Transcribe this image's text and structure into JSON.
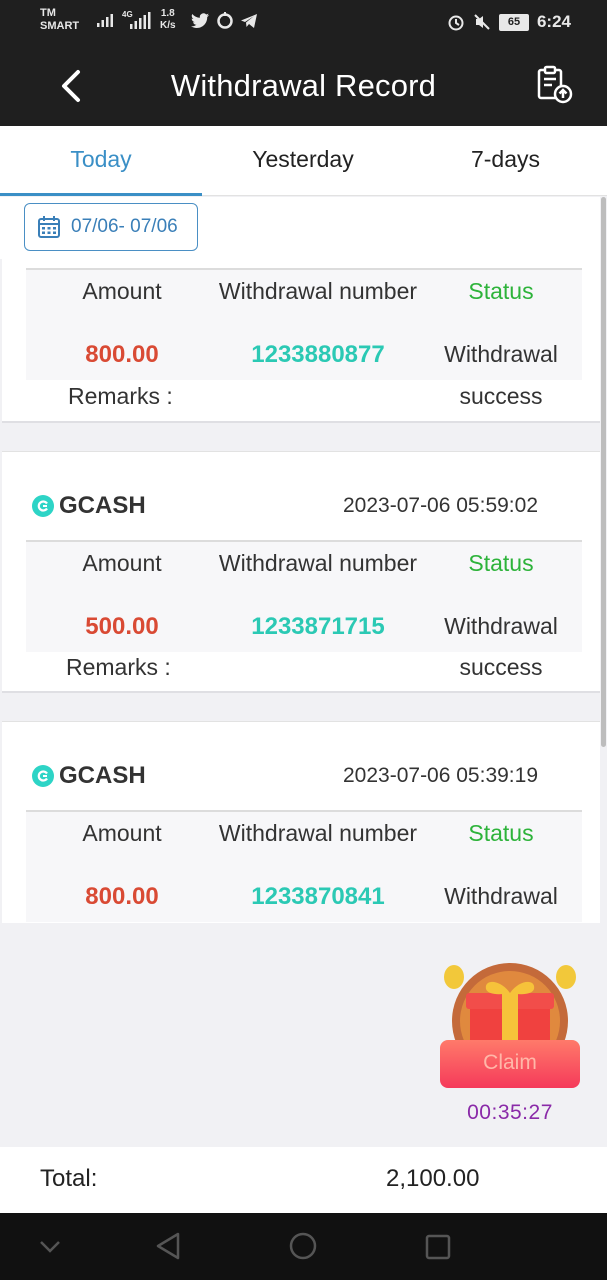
{
  "status_bar": {
    "carrier_line1": "TM",
    "carrier_line2": "SMART",
    "network_type": "4G",
    "speed_value": "1.8",
    "speed_unit": "K/s",
    "battery": "65",
    "time": "6:24"
  },
  "header": {
    "title": "Withdrawal Record"
  },
  "tabs": [
    {
      "label": "Today",
      "active": true
    },
    {
      "label": "Yesterday",
      "active": false
    },
    {
      "label": "7-days",
      "active": false
    }
  ],
  "date_filter": {
    "range": "07/06- 07/06"
  },
  "table_headers": {
    "amount": "Amount",
    "number": "Withdrawal number",
    "status": "Status"
  },
  "remarks_label": "Remarks :",
  "records": [
    {
      "method": "",
      "time": "",
      "amount": "800.00",
      "number": "1233880877",
      "status_line1": "Withdrawal",
      "status_line2": "success"
    },
    {
      "method": "GCASH",
      "time": "2023-07-06 05:59:02",
      "amount": "500.00",
      "number": "1233871715",
      "status_line1": "Withdrawal",
      "status_line2": "success"
    },
    {
      "method": "GCASH",
      "time": "2023-07-06 05:39:19",
      "amount": "800.00",
      "number": "1233870841",
      "status_line1": "Withdrawal",
      "status_line2": ""
    }
  ],
  "gift": {
    "claim_label": "Claim",
    "countdown": "00:35:27"
  },
  "total": {
    "label": "Total:",
    "value": "2,100.00"
  },
  "colors": {
    "accent_blue": "#3a8fc6",
    "status_green": "#2db33a",
    "amount_red": "#d94a34",
    "number_teal": "#2bc9b4",
    "header_bg": "#1f1f1f"
  }
}
